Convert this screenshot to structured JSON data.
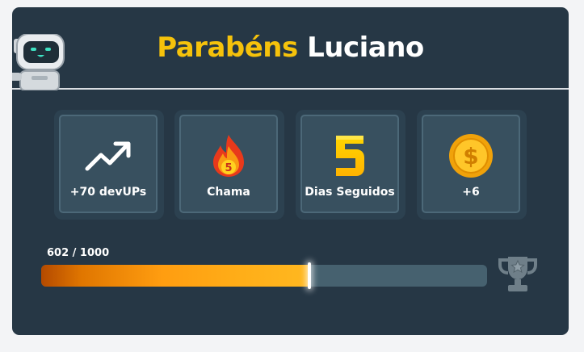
{
  "header": {
    "greeting": "Parabéns",
    "name": "Luciano"
  },
  "stats": [
    {
      "icon": "trending-up-icon",
      "label": "+70 devUPs"
    },
    {
      "icon": "flame-icon",
      "label": "Chama",
      "badge": "5"
    },
    {
      "icon": "number-five-icon",
      "label": "Dias Seguidos"
    },
    {
      "icon": "dollar-coin-icon",
      "label": "+6"
    }
  ],
  "progress": {
    "text": "602 / 1000",
    "current": 602,
    "max": 1000,
    "fraction": 0.602
  },
  "colors": {
    "card_bg": "#263745",
    "accent_yellow": "#f5c20b",
    "progress_orange": "#ff9d10",
    "track": "#46616f"
  }
}
